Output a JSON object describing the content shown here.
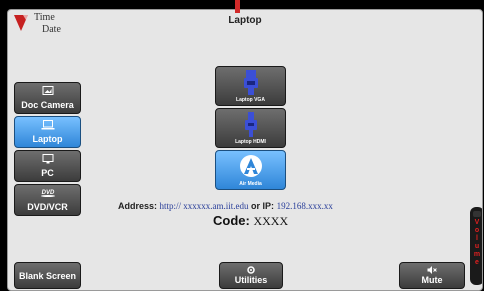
{
  "header": {
    "time": "Time",
    "date": "Date",
    "title": "Laptop"
  },
  "sources": [
    {
      "label": "Doc Camera",
      "icon": "image-icon",
      "active": false
    },
    {
      "label": "Laptop",
      "icon": "laptop-icon",
      "active": true
    },
    {
      "label": "PC",
      "icon": "monitor-icon",
      "active": false
    },
    {
      "label": "DVD/VCR",
      "icon": "dvd-icon",
      "active": false
    }
  ],
  "inputs": [
    {
      "label": "Laptop VGA",
      "icon": "vga-connector-icon",
      "active": false
    },
    {
      "label": "Laptop HDMI",
      "icon": "hdmi-connector-icon",
      "active": false
    },
    {
      "label": "Air Media",
      "icon": "airmedia-icon",
      "active": true
    }
  ],
  "airmedia": {
    "address_prefix": "Address:",
    "address_url": "http:// xxxxxx.am.iit.edu",
    "or_ip": "or IP:",
    "ip": "192.168.xxx.xx",
    "code_label": "Code:",
    "code_value": "XXXX"
  },
  "footer": {
    "blank": "Blank Screen",
    "utilities": "Utilities",
    "mute": "Mute"
  },
  "volume": {
    "label": "Volume",
    "letters": [
      "V",
      "o",
      "l",
      "u",
      "m",
      "e"
    ]
  },
  "colors": {
    "accent": "#4aa3f0",
    "brand_red": "#d22a2a"
  }
}
